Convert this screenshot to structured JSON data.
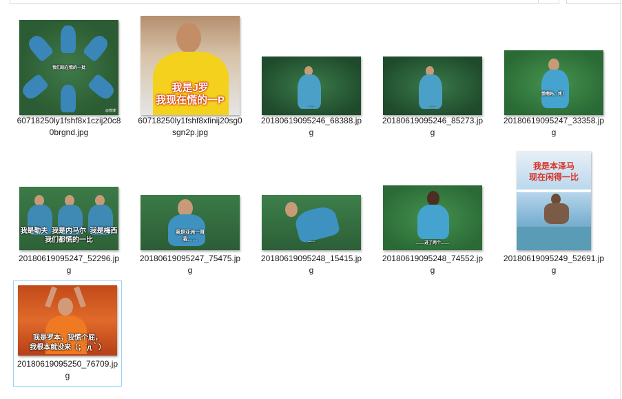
{
  "files": [
    {
      "name": "60718250ly1fshf8x1czij20c80brgnd.jpg",
      "caption": "我们现在慌的一批"
    },
    {
      "name": "60718250ly1fshf8xfinij20sg0sgn2p.jpg",
      "caption": "我是J罗\n我现在慌的一P"
    },
    {
      "name": "20180619095246_68388.jpg",
      "caption": "……"
    },
    {
      "name": "20180619095246_85273.jpg",
      "caption": "……"
    },
    {
      "name": "20180619095247_33358.jpg",
      "caption": "慌啊妈，疼！"
    },
    {
      "name": "20180619095247_52296.jpg",
      "caption": "我是勒夫  我是内马尔  我是梅西\n我们都慌的一比"
    },
    {
      "name": "20180619095247_75475.jpg",
      "caption": "我是亚洲一哥\n我……"
    },
    {
      "name": "20180619095248_15415.jpg",
      "caption": "……"
    },
    {
      "name": "20180619095248_74552.jpg",
      "caption": "……进了两个……"
    },
    {
      "name": "20180619095249_52691.jpg",
      "caption": "我是本泽马\n现在闲得一比"
    },
    {
      "name": "20180619095250_76709.jpg",
      "caption": "我是罗本，我慌个屁，\n我根本就没来（；´д｀）"
    }
  ]
}
